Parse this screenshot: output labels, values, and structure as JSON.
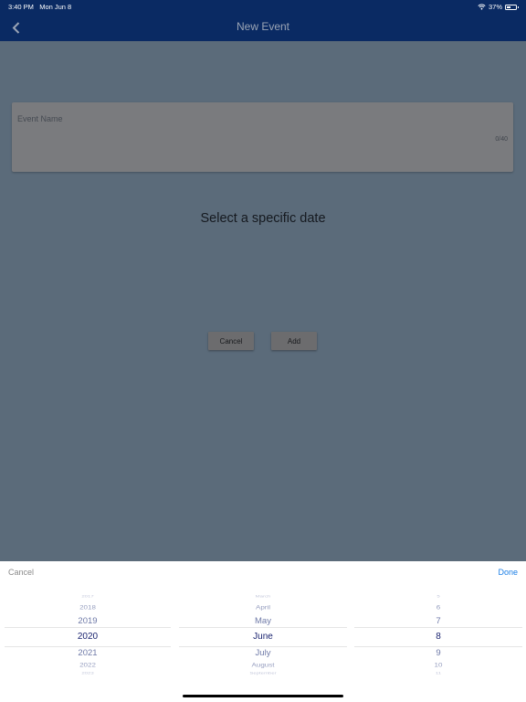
{
  "status_bar": {
    "time": "3:40 PM",
    "date": "Mon Jun 8",
    "battery": "37%"
  },
  "nav": {
    "title": "New Event",
    "back_icon": "chevron-left-icon"
  },
  "form": {
    "event_name_placeholder": "Event Name",
    "event_name_value": "",
    "char_counter": "0/40",
    "section_heading": "Select a specific date"
  },
  "dialog": {
    "cancel_label": "Cancel",
    "add_label": "Add"
  },
  "picker": {
    "cancel_label": "Cancel",
    "done_label": "Done",
    "done_color": "#1a7ee6",
    "years": [
      "2017",
      "2018",
      "2019",
      "2020",
      "2021",
      "2022",
      "2023"
    ],
    "months": [
      "March",
      "April",
      "May",
      "June",
      "July",
      "August",
      "September"
    ],
    "days": [
      "5",
      "6",
      "7",
      "8",
      "9",
      "10",
      "11"
    ],
    "selected": {
      "year": "2020",
      "month": "June",
      "day": "8"
    }
  },
  "colors": {
    "nav_background": "#0a2a63",
    "overlay": "#5b6b7a",
    "picker_selected_text": "#1b2470"
  }
}
